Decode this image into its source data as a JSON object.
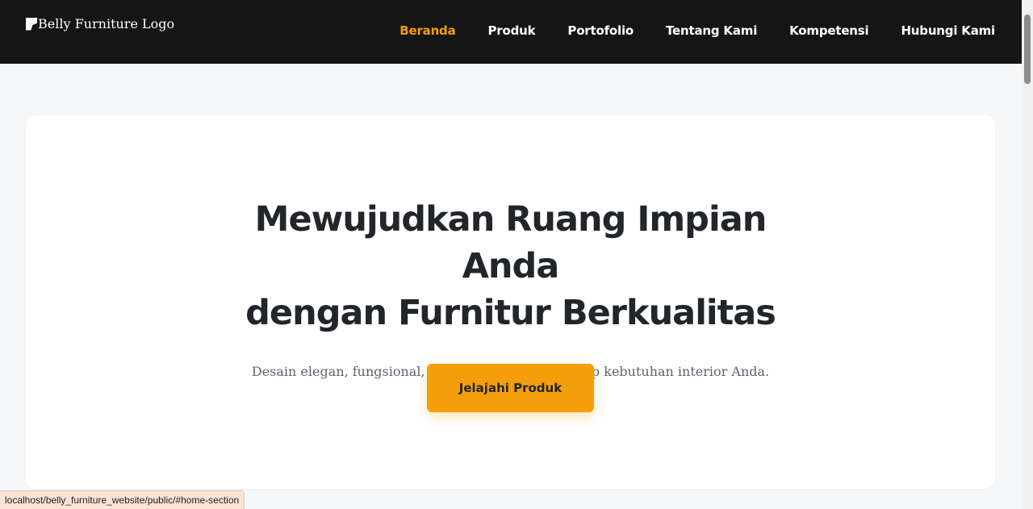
{
  "header": {
    "logo_alt": "Belly Furniture Logo",
    "nav": [
      {
        "label": "Beranda",
        "active": true
      },
      {
        "label": "Produk"
      },
      {
        "label": "Portofolio"
      },
      {
        "label": "Tentang Kami"
      },
      {
        "label": "Kompetensi"
      },
      {
        "label": "Hubungi Kami"
      }
    ]
  },
  "hero": {
    "title_line1": "Mewujudkan Ruang Impian Anda",
    "title_line2": "dengan Furnitur Berkualitas",
    "subtitle": "Desain elegan, fungsional, dan personal untuk setiap kebutuhan interior Anda.",
    "cta_label": "Jelajahi Produk"
  },
  "status_bar": {
    "url": "localhost/belly_furniture_website/public/#home-section"
  },
  "colors": {
    "accent": "#f59e0b",
    "navbar_bg": "#151515",
    "page_bg": "#f6f7f9",
    "text_dark": "#22252a"
  }
}
